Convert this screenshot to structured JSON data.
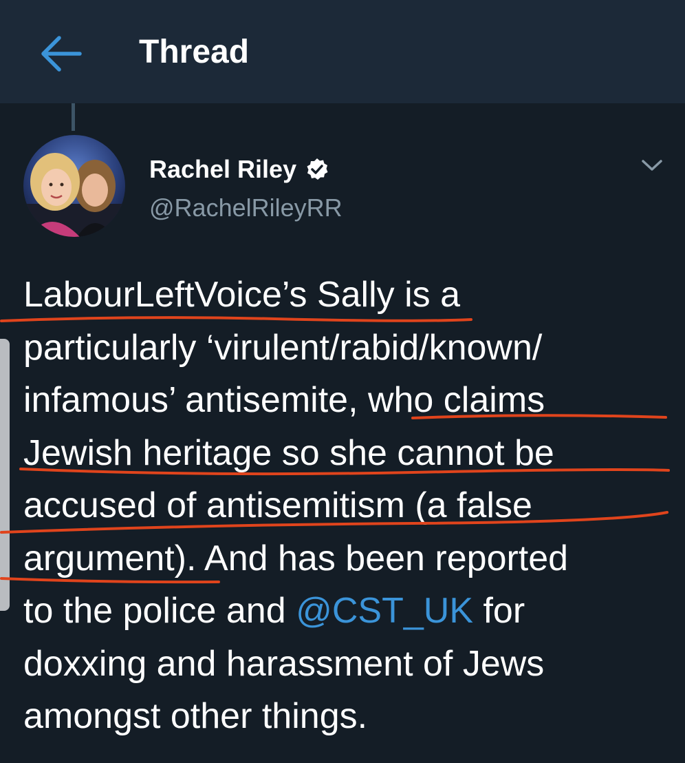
{
  "header": {
    "title": "Thread",
    "back_icon": "arrow-left-icon"
  },
  "tweet": {
    "author_name": "Rachel Riley",
    "handle": "@RachelRileyRR",
    "verified_icon": "verified-badge-icon",
    "menu_icon": "chevron-down-icon",
    "lines": [
      "LabourLeftVoice’s Sally is a",
      "particularly ‘virulent/rabid/known/",
      "infamous’ antisemite, who claims",
      "Jewish heritage so she cannot be",
      "accused of antisemitism (a false",
      "argument). And has been reported"
    ],
    "line7_before": "to the police and ",
    "mention": "@CST_UK",
    "line7_after": " for",
    "line8": "doxxing and harassment of Jews",
    "line9": "amongst other things."
  },
  "colors": {
    "background": "#141d26",
    "header": "#1c2938",
    "accent": "#3b94d9",
    "secondary_text": "#8899a6",
    "annotation_underline": "#e0441c"
  }
}
